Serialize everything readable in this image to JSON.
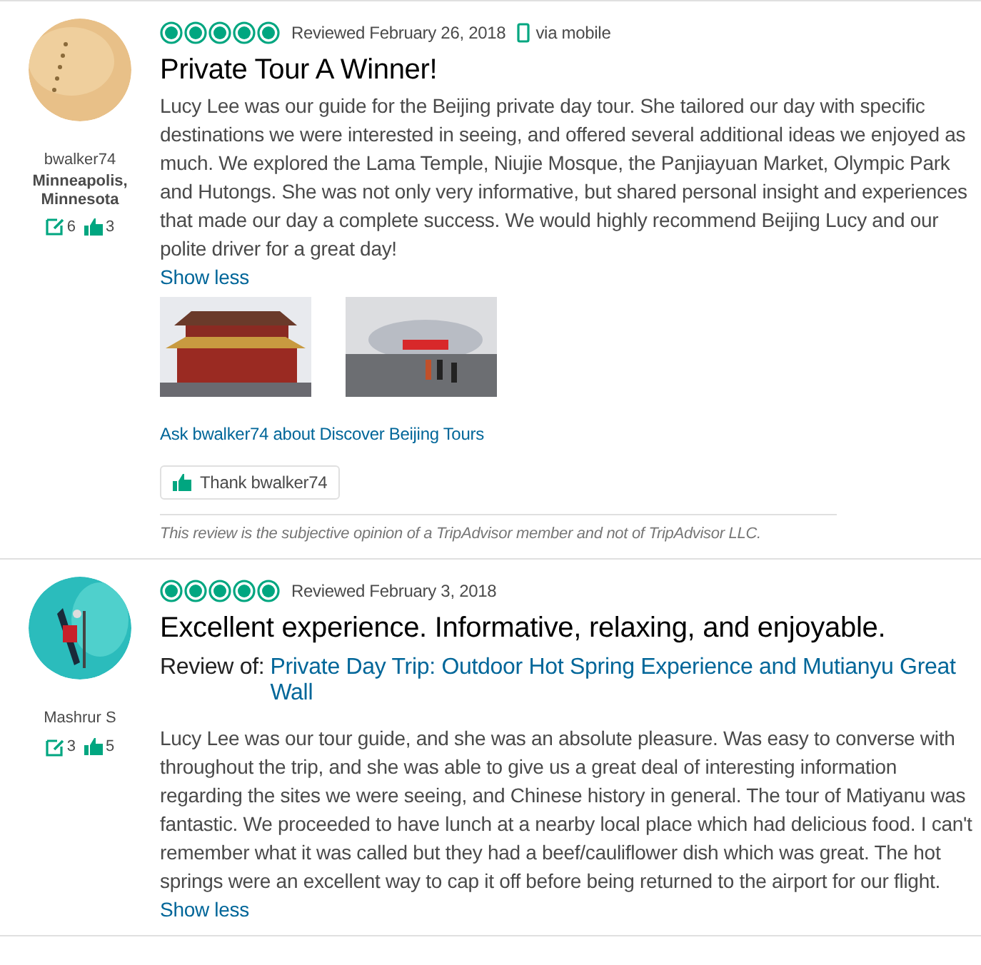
{
  "reviews": [
    {
      "user": {
        "name": "bwalker74",
        "location": "Minneapolis, Minnesota",
        "reviews_count": "6",
        "helpful_count": "3"
      },
      "stars": 5,
      "date": "Reviewed February 26, 2018",
      "via": "via mobile",
      "title": "Private Tour A Winner!",
      "text": "Lucy Lee was our guide for the Beijing private day tour. She tailored our day with specific destinations we were interested in seeing, and offered several additional ideas we enjoyed as much. We explored the Lama Temple, Niujie Mosque, the Panjiayuan Market, Olympic Park and Hutongs. She was not only very informative, but shared personal insight and experiences that made our day a complete success. We would highly recommend Beijing Lucy and our polite driver for a great day!",
      "show_less": "Show less",
      "photos": [
        {
          "kind": "temple"
        },
        {
          "kind": "stadium"
        }
      ],
      "ask": "Ask bwalker74 about Discover Beijing Tours",
      "thank": "Thank bwalker74",
      "disclaimer": "This review is the subjective opinion of a TripAdvisor member and not of TripAdvisor LLC."
    },
    {
      "user": {
        "name": "Mashrur S",
        "reviews_count": "3",
        "helpful_count": "5"
      },
      "stars": 5,
      "date": "Reviewed February 3, 2018",
      "title": "Excellent experience. Informative, relaxing, and enjoyable.",
      "review_of_label": "Review of:",
      "review_of_link": "Private Day Trip: Outdoor Hot Spring Experience and Mutianyu Great Wall",
      "text": "Lucy Lee was our tour guide, and she was an absolute pleasure. Was easy to converse with throughout the trip, and she was able to give us a great deal of interesting information regarding the sites we were seeing, and Chinese history in general. The tour of Matiyanu was fantastic. We proceeded to have lunch at a nearby local place which had delicious food. I can't remember what it was called but they had a beef/cauliflower dish which was great. The hot springs were an excellent way to cap it off before being returned to the airport for our flight.",
      "show_less": "Show less"
    }
  ]
}
